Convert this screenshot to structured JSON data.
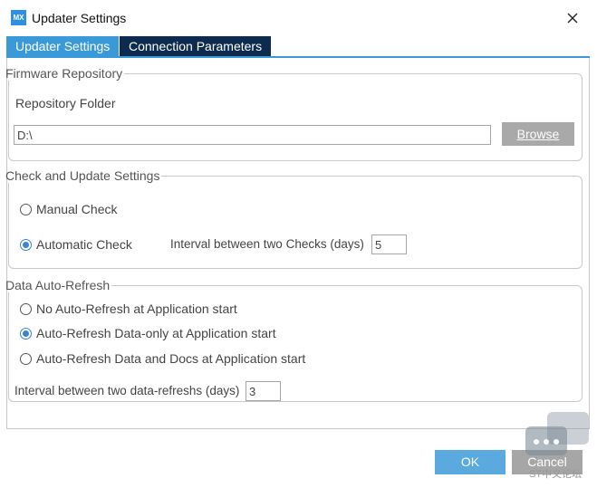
{
  "window": {
    "app_icon_text": "MX",
    "title": "Updater Settings"
  },
  "tabs": [
    {
      "label": "Updater Settings",
      "active": true
    },
    {
      "label": "Connection Parameters",
      "active": false
    }
  ],
  "firmware": {
    "legend": "Firmware Repository",
    "folder_label": "Repository Folder",
    "folder_value": "D:\\",
    "browse_label": "Browse"
  },
  "check": {
    "legend": "Check and Update Settings",
    "manual_label": "Manual Check",
    "automatic_label": "Automatic Check",
    "interval_label": "Interval between two Checks (days)",
    "interval_value": "5",
    "selected": "automatic"
  },
  "refresh": {
    "legend": "Data Auto-Refresh",
    "options": [
      {
        "label": "No Auto-Refresh at Application start",
        "checked": false
      },
      {
        "label": "Auto-Refresh Data-only at Application start",
        "checked": true
      },
      {
        "label": "Auto-Refresh Data and Docs at Application start",
        "checked": false
      }
    ],
    "interval_label": "Interval between two data-refreshs (days)",
    "interval_value": "3"
  },
  "footer": {
    "ok_label": "OK",
    "cancel_label": "Cancel"
  },
  "watermark": {
    "text": "ST中文论坛"
  },
  "colors": {
    "accent": "#3a9ad9",
    "tab_inactive": "#0d2b4e",
    "ok_button": "#5aaadf",
    "cancel_button": "#a6a6a6"
  }
}
